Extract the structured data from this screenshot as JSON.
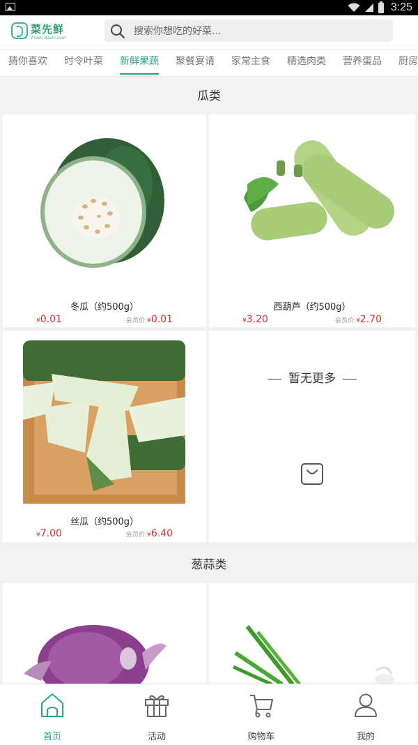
{
  "status_bar": {
    "time": "3:25"
  },
  "header": {
    "logo_text": "菜先鲜",
    "logo_sub": "Fresh Asahi.com",
    "search_placeholder": "搜索你想吃的好菜..."
  },
  "tabs": [
    {
      "label": "猜你喜欢",
      "active": false
    },
    {
      "label": "时令叶菜",
      "active": false
    },
    {
      "label": "新鲜果蔬",
      "active": true
    },
    {
      "label": "聚餐宴请",
      "active": false
    },
    {
      "label": "家常主食",
      "active": false
    },
    {
      "label": "精选肉类",
      "active": false
    },
    {
      "label": "营养蛋品",
      "active": false
    },
    {
      "label": "厨房",
      "active": false
    }
  ],
  "sections": [
    {
      "title": "瓜类",
      "products": [
        {
          "name": "冬瓜（约500g）",
          "currency": "¥",
          "price": "0.01",
          "member_label": "会员价:",
          "member_price": "0.01"
        },
        {
          "name": "西葫芦（约500g）",
          "currency": "¥",
          "price": "3.20",
          "member_label": "会员价:",
          "member_price": "2.70"
        },
        {
          "name": "丝瓜（约500g）",
          "currency": "¥",
          "price": "7.00",
          "member_label": "会员价:",
          "member_price": "6.40"
        }
      ],
      "no_more": "暂无更多"
    },
    {
      "title": "葱蒜类"
    }
  ],
  "bottom_nav": [
    {
      "label": "首页",
      "icon": "home-icon",
      "active": true
    },
    {
      "label": "活动",
      "icon": "gift-icon",
      "active": false
    },
    {
      "label": "购物车",
      "icon": "cart-icon",
      "active": false
    },
    {
      "label": "我的",
      "icon": "user-icon",
      "active": false
    }
  ],
  "colors": {
    "accent": "#2aa587",
    "price": "#d8322c"
  }
}
